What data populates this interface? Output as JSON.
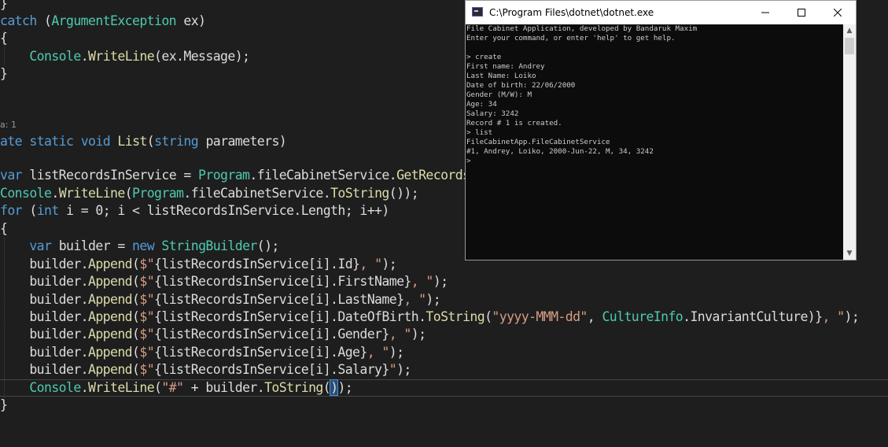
{
  "editor": {
    "reference_lens": "a: 1",
    "lines": [
      [
        {
          "t": "}",
          "c": ""
        }
      ],
      [
        {
          "t": "catch",
          "c": "kw"
        },
        {
          "t": " (",
          "c": ""
        },
        {
          "t": "ArgumentException",
          "c": "ty"
        },
        {
          "t": " ex)",
          "c": ""
        }
      ],
      [
        {
          "t": "{",
          "c": ""
        }
      ],
      [
        {
          "t": "    ",
          "c": ""
        },
        {
          "t": "Console",
          "c": "ty"
        },
        {
          "t": ".",
          "c": ""
        },
        {
          "t": "WriteLine",
          "c": "me"
        },
        {
          "t": "(ex.Message);",
          "c": ""
        }
      ],
      [
        {
          "t": "}",
          "c": ""
        }
      ],
      [
        {
          "t": "ate",
          "c": "kw"
        },
        {
          "t": " ",
          "c": ""
        },
        {
          "t": "static",
          "c": "kw"
        },
        {
          "t": " ",
          "c": ""
        },
        {
          "t": "void",
          "c": "kw"
        },
        {
          "t": " ",
          "c": ""
        },
        {
          "t": "List",
          "c": "me"
        },
        {
          "t": "(",
          "c": ""
        },
        {
          "t": "string",
          "c": "kw"
        },
        {
          "t": " parameters)",
          "c": ""
        }
      ],
      [
        {
          "t": "var",
          "c": "kw"
        },
        {
          "t": " listRecordsInService = ",
          "c": ""
        },
        {
          "t": "Program",
          "c": "ty"
        },
        {
          "t": ".fileCabinetService.",
          "c": ""
        },
        {
          "t": "GetRecords",
          "c": "me"
        }
      ],
      [
        {
          "t": "Console",
          "c": "ty"
        },
        {
          "t": ".",
          "c": ""
        },
        {
          "t": "WriteLine",
          "c": "me"
        },
        {
          "t": "(",
          "c": ""
        },
        {
          "t": "Program",
          "c": "ty"
        },
        {
          "t": ".fileCabinetService.",
          "c": ""
        },
        {
          "t": "ToString",
          "c": "me"
        },
        {
          "t": "());",
          "c": ""
        }
      ],
      [
        {
          "t": "for",
          "c": "kw"
        },
        {
          "t": " (",
          "c": ""
        },
        {
          "t": "int",
          "c": "kw"
        },
        {
          "t": " i = 0; i < listRecordsInService.Length; i++)",
          "c": ""
        }
      ],
      [
        {
          "t": "{",
          "c": ""
        }
      ],
      [
        {
          "t": "    ",
          "c": ""
        },
        {
          "t": "var",
          "c": "kw"
        },
        {
          "t": " builder = ",
          "c": ""
        },
        {
          "t": "new",
          "c": "kw"
        },
        {
          "t": " ",
          "c": ""
        },
        {
          "t": "StringBuilder",
          "c": "ty"
        },
        {
          "t": "();",
          "c": ""
        }
      ],
      [
        {
          "t": "    builder.",
          "c": ""
        },
        {
          "t": "Append",
          "c": "me"
        },
        {
          "t": "(",
          "c": ""
        },
        {
          "t": "$\"",
          "c": "str"
        },
        {
          "t": "{listRecordsInService[i].Id}",
          "c": ""
        },
        {
          "t": ", \"",
          "c": "str"
        },
        {
          "t": ");",
          "c": ""
        }
      ],
      [
        {
          "t": "    builder.",
          "c": ""
        },
        {
          "t": "Append",
          "c": "me"
        },
        {
          "t": "(",
          "c": ""
        },
        {
          "t": "$\"",
          "c": "str"
        },
        {
          "t": "{listRecordsInService[i].FirstName}",
          "c": ""
        },
        {
          "t": ", \"",
          "c": "str"
        },
        {
          "t": ");",
          "c": ""
        }
      ],
      [
        {
          "t": "    builder.",
          "c": ""
        },
        {
          "t": "Append",
          "c": "me"
        },
        {
          "t": "(",
          "c": ""
        },
        {
          "t": "$\"",
          "c": "str"
        },
        {
          "t": "{listRecordsInService[i].LastName}",
          "c": ""
        },
        {
          "t": ", \"",
          "c": "str"
        },
        {
          "t": ");",
          "c": ""
        }
      ],
      [
        {
          "t": "    builder.",
          "c": ""
        },
        {
          "t": "Append",
          "c": "me"
        },
        {
          "t": "(",
          "c": ""
        },
        {
          "t": "$\"",
          "c": "str"
        },
        {
          "t": "{listRecordsInService[i].DateOfBirth.",
          "c": ""
        },
        {
          "t": "ToString",
          "c": "me"
        },
        {
          "t": "(",
          "c": ""
        },
        {
          "t": "\"yyyy-MMM-dd\"",
          "c": "str"
        },
        {
          "t": ", ",
          "c": ""
        },
        {
          "t": "CultureInfo",
          "c": "ty"
        },
        {
          "t": ".InvariantCulture)}",
          "c": ""
        },
        {
          "t": ", \"",
          "c": "str"
        },
        {
          "t": ");",
          "c": ""
        }
      ],
      [
        {
          "t": "    builder.",
          "c": ""
        },
        {
          "t": "Append",
          "c": "me"
        },
        {
          "t": "(",
          "c": ""
        },
        {
          "t": "$\"",
          "c": "str"
        },
        {
          "t": "{listRecordsInService[i].Gender}",
          "c": ""
        },
        {
          "t": ", \"",
          "c": "str"
        },
        {
          "t": ");",
          "c": ""
        }
      ],
      [
        {
          "t": "    builder.",
          "c": ""
        },
        {
          "t": "Append",
          "c": "me"
        },
        {
          "t": "(",
          "c": ""
        },
        {
          "t": "$\"",
          "c": "str"
        },
        {
          "t": "{listRecordsInService[i].Age}",
          "c": ""
        },
        {
          "t": ", \"",
          "c": "str"
        },
        {
          "t": ");",
          "c": ""
        }
      ],
      [
        {
          "t": "    builder.",
          "c": ""
        },
        {
          "t": "Append",
          "c": "me"
        },
        {
          "t": "(",
          "c": ""
        },
        {
          "t": "$\"",
          "c": "str"
        },
        {
          "t": "{listRecordsInService[i].Salary}",
          "c": ""
        },
        {
          "t": "\"",
          "c": "str"
        },
        {
          "t": ");",
          "c": ""
        }
      ],
      [
        {
          "t": "    ",
          "c": ""
        },
        {
          "t": "Console",
          "c": "ty"
        },
        {
          "t": ".",
          "c": ""
        },
        {
          "t": "WriteLine",
          "c": "me"
        },
        {
          "t": "(",
          "c": ""
        },
        {
          "t": "\"#\"",
          "c": "str"
        },
        {
          "t": " + builder.",
          "c": ""
        },
        {
          "t": "ToString",
          "c": "me"
        },
        {
          "t": "(",
          "c": ""
        },
        {
          "t": ")",
          "c": "brace-hl"
        },
        {
          "t": ");",
          "c": ""
        }
      ],
      [
        {
          "t": "}",
          "c": ""
        }
      ]
    ]
  },
  "console": {
    "window_title": "C:\\Program Files\\dotnet\\dotnet.exe",
    "lines": [
      "File Cabinet Application, developed by Bandaruk Maxim",
      "Enter your command, or enter 'help' to get help.",
      "",
      "> create",
      "First name: Andrey",
      "Last Name: Loiko",
      "Date of birth: 22/06/2000",
      "Gender (M/W): M",
      "Age: 34",
      "Salary: 3242",
      "Record # 1 is created.",
      "> list",
      "FileCabinetApp.FileCabinetService",
      "#1, Andrey, Loiko, 2000-Jun-22, M, 34, 3242",
      ">"
    ]
  },
  "colors": {
    "editor_bg": "#1e1e1e",
    "keyword": "#569cd6",
    "type": "#4ec9b0",
    "method": "#dcdcaa",
    "string": "#d69d85",
    "console_bg": "#0c0c0c",
    "console_text": "#cccccc"
  },
  "icons": {
    "app": "console-app-icon",
    "minimize": "minimize-icon",
    "maximize": "maximize-icon",
    "close": "close-icon",
    "scroll_up": "scroll-up-arrow-icon",
    "scroll_down": "scroll-down-arrow-icon"
  }
}
